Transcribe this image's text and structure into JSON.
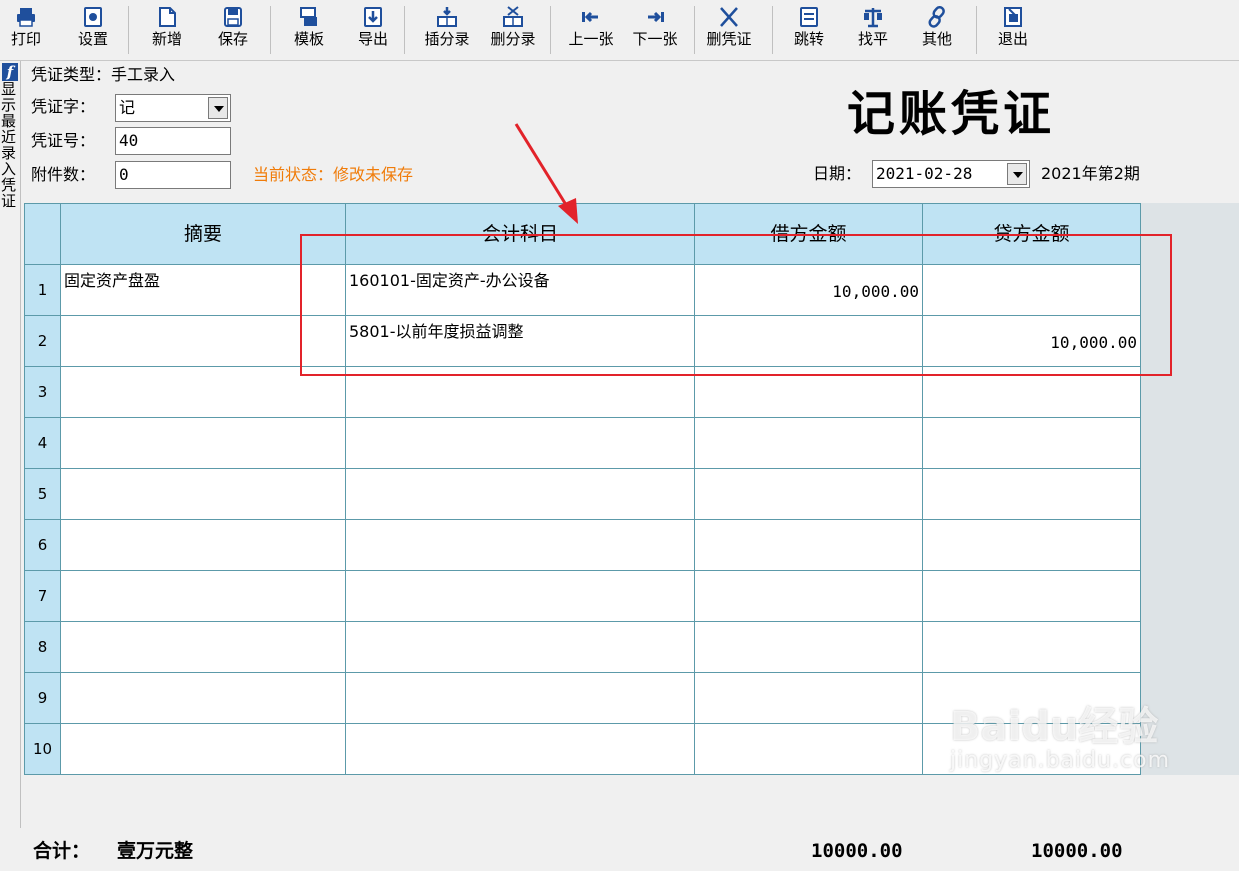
{
  "toolbar": {
    "buttons": [
      {
        "label": "打印",
        "icon": "printer-icon"
      },
      {
        "label": "设置",
        "icon": "gear-icon"
      },
      {
        "label": "新增",
        "icon": "new-document-icon"
      },
      {
        "label": "保存",
        "icon": "save-icon"
      },
      {
        "label": "模板",
        "icon": "template-icon"
      },
      {
        "label": "导出",
        "icon": "export-icon"
      },
      {
        "label": "插分录",
        "icon": "insert-row-icon"
      },
      {
        "label": "删分录",
        "icon": "delete-row-icon"
      },
      {
        "label": "上一张",
        "icon": "previous-icon"
      },
      {
        "label": "下一张",
        "icon": "next-icon"
      },
      {
        "label": "删凭证",
        "icon": "delete-voucher-icon"
      },
      {
        "label": "跳转",
        "icon": "jump-icon"
      },
      {
        "label": "找平",
        "icon": "balance-scale-icon"
      },
      {
        "label": "其他",
        "icon": "link-icon"
      },
      {
        "label": "退出",
        "icon": "exit-icon"
      }
    ]
  },
  "sidebar": {
    "logo": "f",
    "vertical_label": "显示最近录入凭证"
  },
  "header": {
    "voucher_type_label": "凭证类型：",
    "voucher_type_value": "手工录入",
    "voucher_word_label": "凭证字：",
    "voucher_word_value": "记",
    "voucher_no_label": "凭证号：",
    "voucher_no_value": "40",
    "attachments_label": "附件数：",
    "attachments_value": "0",
    "status_text": "当前状态：修改未保存",
    "status_color": "#f07c0a",
    "title": "记账凭证",
    "date_label": "日期：",
    "date_value": "2021-02-28",
    "period": "2021年第2期"
  },
  "grid": {
    "headers": [
      "摘要",
      "会计科目",
      "借方金额",
      "贷方金额"
    ],
    "header_bg": "#bfe3f3",
    "rows": [
      {
        "no": "1",
        "summary": "固定资产盘盈",
        "account": "160101-固定资产-办公设备",
        "debit": "10,000.00",
        "credit": ""
      },
      {
        "no": "2",
        "summary": "",
        "account": "5801-以前年度损益调整",
        "debit": "",
        "credit": "10,000.00"
      },
      {
        "no": "3",
        "summary": "",
        "account": "",
        "debit": "",
        "credit": ""
      },
      {
        "no": "4",
        "summary": "",
        "account": "",
        "debit": "",
        "credit": ""
      },
      {
        "no": "5",
        "summary": "",
        "account": "",
        "debit": "",
        "credit": ""
      },
      {
        "no": "6",
        "summary": "",
        "account": "",
        "debit": "",
        "credit": ""
      },
      {
        "no": "7",
        "summary": "",
        "account": "",
        "debit": "",
        "credit": ""
      },
      {
        "no": "8",
        "summary": "",
        "account": "",
        "debit": "",
        "credit": ""
      },
      {
        "no": "9",
        "summary": "",
        "account": "",
        "debit": "",
        "credit": ""
      },
      {
        "no": "10",
        "summary": "",
        "account": "",
        "debit": "",
        "credit": ""
      }
    ]
  },
  "footer": {
    "total_label": "合计：",
    "total_words": "壹万元整",
    "debit_total": "10000.00",
    "credit_total": "10000.00"
  },
  "annotation": {
    "highlight_color": "#e2232a"
  },
  "watermark": {
    "text": "Baidu经验",
    "sub": "jingyan.baidu.com"
  }
}
